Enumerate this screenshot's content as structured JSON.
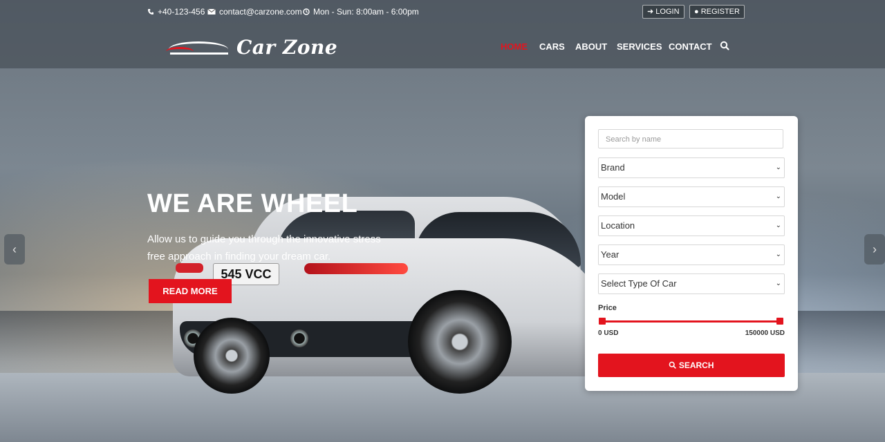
{
  "topbar": {
    "phone": "+40-123-456",
    "email": "contact@carzone.com",
    "hours": "Mon - Sun: 8:00am - 6:00pm",
    "login_label": "LOGIN",
    "register_label": "REGISTER"
  },
  "brand": {
    "name": "Car Zone"
  },
  "nav": {
    "items": [
      {
        "label": "HOME",
        "active": true
      },
      {
        "label": "CARS"
      },
      {
        "label": "ABOUT"
      },
      {
        "label": "SERVICES"
      },
      {
        "label": "CONTACT"
      }
    ]
  },
  "hero": {
    "title": "WE ARE WHEEL",
    "subtitle": "Allow us to guide you through the innovative stress free approach in finding your dream car.",
    "cta_label": "READ MORE",
    "plate_text": "545 VCC"
  },
  "search": {
    "name_placeholder": "Search by name",
    "selects": [
      "Brand",
      "Model",
      "Location",
      "Year",
      "Select Type Of Car"
    ],
    "price_label": "Price",
    "price_min": "0 USD",
    "price_max": "150000 USD",
    "button_label": "SEARCH"
  },
  "colors": {
    "accent": "#e3141e"
  },
  "icons": {
    "phone": "phone-icon",
    "email": "envelope-icon",
    "hours": "clock-icon",
    "login": "sign-in-icon",
    "register": "user-icon",
    "nav_search": "search-icon",
    "button_search": "search-icon"
  }
}
